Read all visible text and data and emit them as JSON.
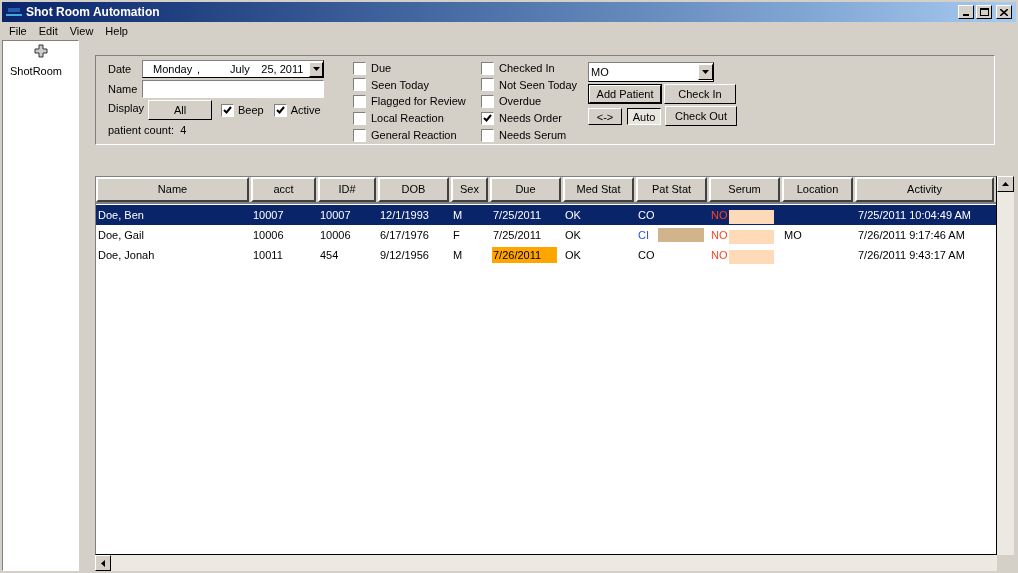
{
  "window": {
    "title": "Shot Room Automation"
  },
  "menu": [
    "File",
    "Edit",
    "View",
    "Help"
  ],
  "sidebar": {
    "items": [
      {
        "label": "ShotRoom",
        "selected": false
      }
    ]
  },
  "filters": {
    "date_label": "Date",
    "date": {
      "weekday": "Monday",
      "sep": ",",
      "month": "July",
      "day_year": "25, 2011"
    },
    "name_label": "Name",
    "display_label": "Display",
    "display_button": "All",
    "beep": {
      "label": "Beep",
      "checked": true
    },
    "active": {
      "label": "Active",
      "checked": true
    },
    "patient_count": "patient count:  4",
    "checks": [
      {
        "label": "Due",
        "checked": false
      },
      {
        "label": "Seen Today",
        "checked": false
      },
      {
        "label": "Flagged for Review",
        "checked": false
      },
      {
        "label": "Local Reaction",
        "checked": false
      },
      {
        "label": "General Reaction",
        "checked": false
      },
      {
        "label": "Checked In",
        "checked": false
      },
      {
        "label": "Not Seen Today",
        "checked": false
      },
      {
        "label": "Overdue",
        "checked": false
      },
      {
        "label": "Needs Order",
        "checked": true
      },
      {
        "label": "Needs Serum",
        "checked": false
      }
    ],
    "location": "MO",
    "buttons": {
      "add": "Add Patient",
      "check_in": "Check In",
      "swap": "<->",
      "auto": "Auto",
      "check_out": "Check Out"
    }
  },
  "table": {
    "columns": [
      "Name",
      "acct",
      "ID#",
      "DOB",
      "Sex",
      "Due",
      "Med Stat",
      "Pat Stat",
      "Serum",
      "Location",
      "Activity"
    ],
    "rows": [
      {
        "selected": true,
        "name": "Doe, Ben",
        "acct": "10007",
        "id": "10007",
        "dob": "12/1/1993",
        "sex": "M",
        "due": "7/25/2011",
        "due_flagged": false,
        "med_stat": "OK",
        "pat_stat": {
          "code": "CO",
          "kind": "out"
        },
        "pat_swatch": false,
        "serum": "NO",
        "location": "",
        "activity": "7/25/2011 10:04:49 AM"
      },
      {
        "selected": false,
        "name": "Doe, Gail",
        "acct": "10006",
        "id": "10006",
        "dob": "6/17/1976",
        "sex": "F",
        "due": "7/25/2011",
        "due_flagged": false,
        "med_stat": "OK",
        "pat_stat": {
          "code": "CI",
          "kind": "in"
        },
        "pat_swatch": true,
        "serum": "NO",
        "location": "MO",
        "activity": "7/26/2011 9:17:46 AM"
      },
      {
        "selected": false,
        "name": "Doe, Jonah",
        "acct": "10011",
        "id": "454",
        "dob": "9/12/1956",
        "sex": "M",
        "due": "7/26/2011",
        "due_flagged": true,
        "med_stat": "OK",
        "pat_stat": {
          "code": "CO",
          "kind": "out"
        },
        "pat_swatch": false,
        "serum": "NO",
        "location": "",
        "activity": "7/26/2011 9:43:17 AM"
      }
    ]
  }
}
